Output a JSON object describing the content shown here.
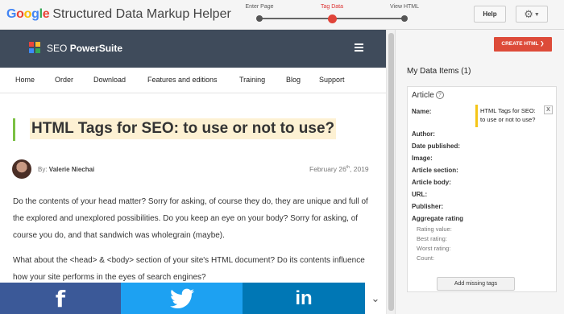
{
  "header": {
    "logo_text": "Google",
    "title": "Structured Data Markup Helper",
    "steps": [
      {
        "label": "Enter Page",
        "active": false
      },
      {
        "label": "Tag Data",
        "active": true
      },
      {
        "label": "View HTML",
        "active": false
      }
    ],
    "help_label": "Help",
    "settings_icon": "gear-icon"
  },
  "site": {
    "brand_prefix": "SEO",
    "brand_name": "PowerSuite",
    "menu_icon": "hamburger-icon",
    "nav": [
      "Home",
      "Order",
      "Download",
      "Features and editions",
      "Training",
      "Blog",
      "Support"
    ],
    "article_title": "HTML Tags for SEO: to use or not to use?",
    "byline_prefix": "By:",
    "author": "Valerie Niechai",
    "date_prefix": "February 26",
    "date_sup": "th",
    "date_year": ", 2019",
    "paragraph1": "Do the contents of your head matter? Sorry for asking, of course they do, they are unique and full of the explored and unexplored possibilities. Do you keep an eye on your body? Sorry for asking, of course you do, and that sandwich was wholegrain (maybe).",
    "paragraph2": "What about the <head> & <body> section of your site's HTML document? Do its contents influence how your site performs in the eyes of search engines?",
    "share": {
      "facebook_glyph": "f",
      "linkedin_glyph": "in",
      "more_icon": "chevron-down-icon"
    }
  },
  "panel": {
    "create_label": "CREATE HTML",
    "my_data_label": "My Data Items (1)",
    "item_type": "Article",
    "name_label": "Name:",
    "name_value": "HTML Tags for SEO: to use or not to use?",
    "remove_label": "X",
    "fields": [
      "Author:",
      "Date published:",
      "Image:",
      "Article section:",
      "Article body:",
      "URL:",
      "Publisher:",
      "Aggregate rating"
    ],
    "rating_subfields": [
      "Rating value:",
      "Best rating:",
      "Worst rating:",
      "Count:"
    ],
    "add_missing_label": "Add missing tags"
  },
  "colors": {
    "google_blue": "#4285f4",
    "google_red": "#ea4335",
    "google_yellow": "#fbbc05",
    "google_green": "#34a853",
    "site_header": "#3f4b5b",
    "accent_red": "#dd4b39",
    "facebook": "#3b5998",
    "twitter": "#1da1f2",
    "linkedin": "#0077b5"
  }
}
